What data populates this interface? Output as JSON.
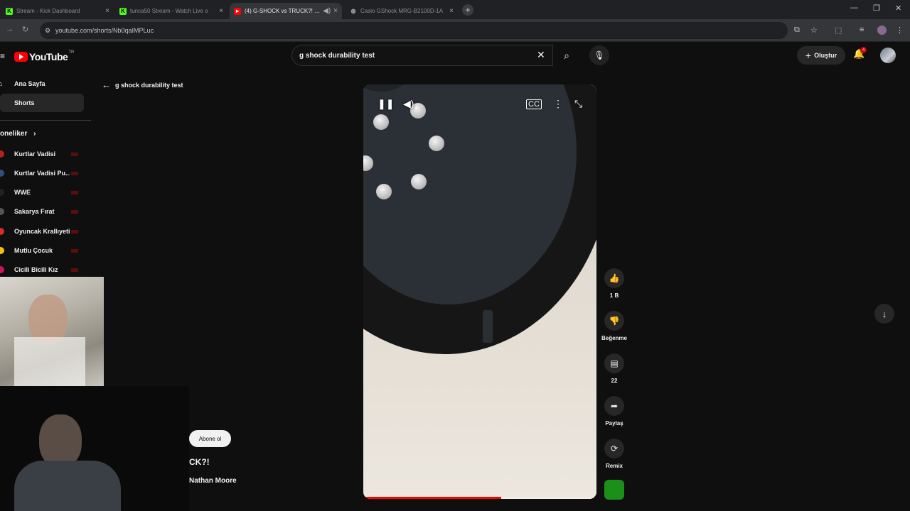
{
  "browser": {
    "tabs": [
      {
        "title": "Stream - Kick Dashboard",
        "active": false,
        "favicon": "kick-icon"
      },
      {
        "title": "tunca50 Stream - Watch Live o",
        "active": false,
        "favicon": "kick-icon"
      },
      {
        "title": "(4) G-SHOCK vs TRUCK?! - Y",
        "active": true,
        "favicon": "youtube-icon"
      },
      {
        "title": "Casio GShock MRG-B2100D-1A",
        "active": false,
        "favicon": "globe-icon"
      }
    ],
    "url": "youtube.com/shorts/Nb0qaIMPLuc"
  },
  "header": {
    "logo_text": "YouTube",
    "country_code": "TR",
    "search_value": "g shock durability test",
    "create_label": "Oluştur",
    "notification_count": "4"
  },
  "sidebar": {
    "items": [
      {
        "label": "Ana Sayfa",
        "selected": false
      },
      {
        "label": "Shorts",
        "selected": true
      }
    ],
    "subscriptions_heading": "oneliker",
    "subscriptions": [
      {
        "name": "Kurtlar Vadisi",
        "color": "#b22222"
      },
      {
        "name": "Kurtlar Vadisi Pu...",
        "color": "#2f4f7f"
      },
      {
        "name": "WWE",
        "color": "#222222"
      },
      {
        "name": "Sakarya Fırat",
        "color": "#555555"
      },
      {
        "name": "Oyuncak Krallıyeti",
        "color": "#d62b2b"
      },
      {
        "name": "Mutlu Çocuk",
        "color": "#f4c20d"
      },
      {
        "name": "Cicili Bicili Kız",
        "color": "#c2185b"
      }
    ]
  },
  "main": {
    "back_label": "g shock durability test",
    "subscribe_label": "Abone ol",
    "video_title_fragment": "CK?!",
    "channel_name": "Nathan Moore",
    "progress": 0.59
  },
  "actions": {
    "like_count": "1 B",
    "dislike_label": "Beğenme",
    "comment_count": "22",
    "share_label": "Paylaş",
    "remix_label": "Remix"
  }
}
